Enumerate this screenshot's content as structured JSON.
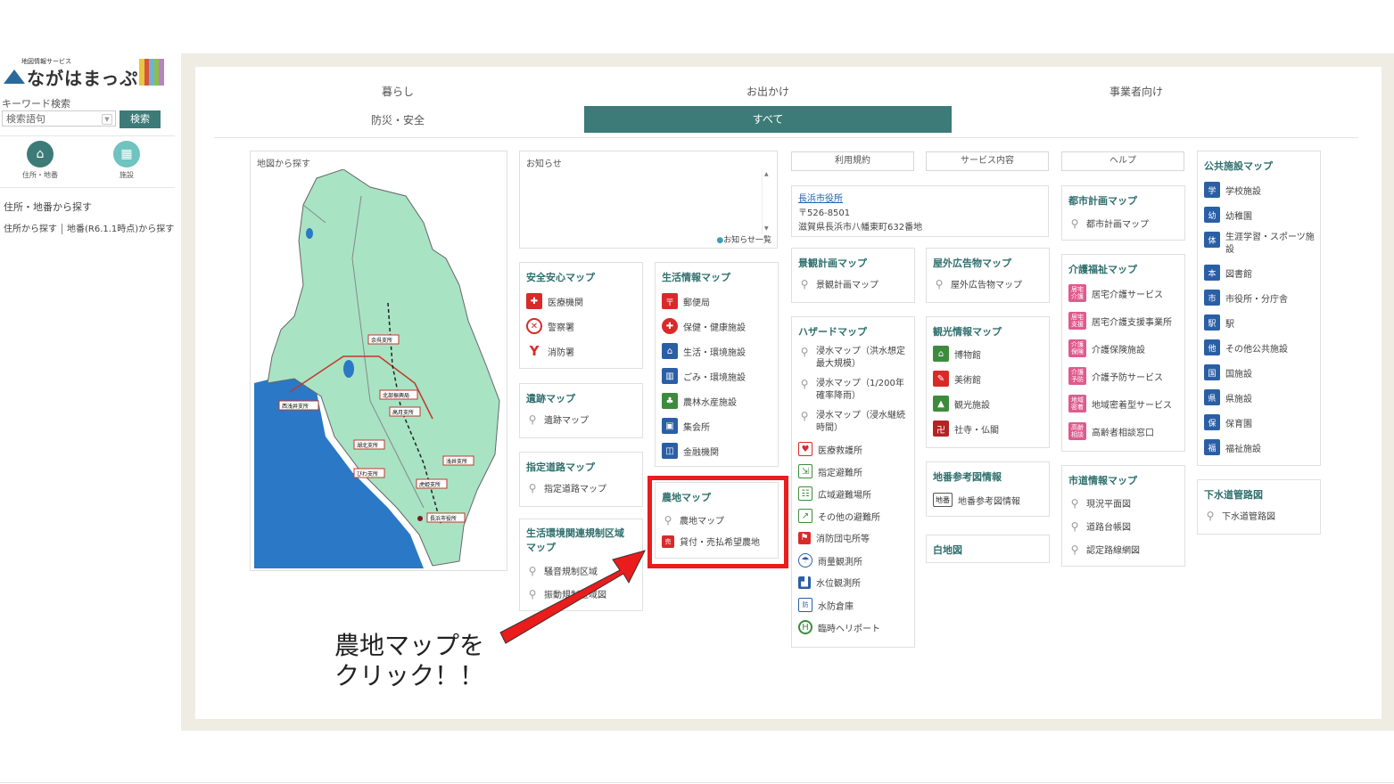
{
  "sidebar": {
    "logo_small": "地図情報サービス",
    "logo_text": "ながはまっぷ",
    "keyword_label": "キーワード検索",
    "search_placeholder": "検索語句",
    "search_button": "検索",
    "icon1_label": "住所・地番",
    "icon2_label": "施設",
    "search_title": "住所・地番から探す",
    "link_address": "住所から探す",
    "link_lot": "地番(R6.1.1時点)から探す"
  },
  "tabs": {
    "living": "暮らし",
    "outing": "お出かけ",
    "business": "事業者向け",
    "disaster": "防災・安全",
    "all": "すべて"
  },
  "map_panel": {
    "title": "地図から探す",
    "labels": [
      "余呉支所",
      "北部振興局",
      "高月支所",
      "西浅井支所",
      "湖北支所",
      "びわ支所",
      "浅井支所",
      "虎姫支所",
      "長浜市役所"
    ]
  },
  "news": {
    "title": "お知らせ",
    "list_link": "お知らせ一覧"
  },
  "top_buttons": {
    "terms": "利用規約",
    "service": "サービス内容",
    "help": "ヘルプ"
  },
  "city_office": {
    "name": "長浜市役所",
    "postal": "〒526-8501",
    "address": "滋賀県長浜市八幡東町632番地"
  },
  "safety": {
    "title": "安全安心マップ",
    "items": [
      "医療機関",
      "警察署",
      "消防署"
    ]
  },
  "ruins": {
    "title": "遺跡マップ",
    "items": [
      "遺跡マップ"
    ]
  },
  "road": {
    "title": "指定道路マップ",
    "items": [
      "指定道路マップ"
    ]
  },
  "env": {
    "title": "生活環境関連規制区域マップ",
    "items": [
      "騒音規制区域",
      "振動規制区域図"
    ]
  },
  "life": {
    "title": "生活情報マップ",
    "items": [
      "郵便局",
      "保健・健康施設",
      "生活・環境施設",
      "ごみ・環境施設",
      "農林水産施設",
      "集会所",
      "金融機関"
    ]
  },
  "farm": {
    "title": "農地マップ",
    "items": [
      "農地マップ",
      "貸付・売払希望農地"
    ]
  },
  "landscape": {
    "title": "景観計画マップ",
    "items": [
      "景観計画マップ"
    ]
  },
  "outdoor_ad": {
    "title": "屋外広告物マップ",
    "items": [
      "屋外広告物マップ"
    ]
  },
  "hazard": {
    "title": "ハザードマップ",
    "items": [
      "浸水マップ（洪水想定最大規模）",
      "浸水マップ（1/200年確率降雨）",
      "浸水マップ（浸水継続時間）",
      "医療救護所",
      "指定避難所",
      "広域避難場所",
      "その他の避難所",
      "消防団屯所等",
      "雨量観測所",
      "水位観測所",
      "水防倉庫",
      "臨時ヘリポート"
    ]
  },
  "tourism": {
    "title": "観光情報マップ",
    "items": [
      "博物館",
      "美術館",
      "観光施設",
      "社寺・仏閣"
    ]
  },
  "lot_ref": {
    "title": "地番参考図情報",
    "items": [
      "地番参考図情報"
    ],
    "icon_text": "地番"
  },
  "blank_map": {
    "title": "白地図"
  },
  "urban": {
    "title": "都市計画マップ",
    "items": [
      "都市計画マップ"
    ]
  },
  "care": {
    "title": "介護福祉マップ",
    "items": [
      "居宅介護サービス",
      "居宅介護支援事業所",
      "介護保険施設",
      "介護予防サービス",
      "地域密着型サービス",
      "高齢者相談窓口"
    ],
    "icon_texts": [
      "居宅介護",
      "居宅支援",
      "介護保険",
      "介護予防",
      "地域密着",
      "高齢相談"
    ]
  },
  "road_info": {
    "title": "市道情報マップ",
    "items": [
      "現況平面図",
      "道路台帳図",
      "認定路線網図"
    ]
  },
  "public": {
    "title": "公共施設マップ",
    "items": [
      "学校施設",
      "幼稚園",
      "生涯学習・スポーツ施設",
      "図書館",
      "市役所・分庁舎",
      "駅",
      "その他公共施設",
      "国施設",
      "県施設",
      "保育園",
      "福祉施設"
    ],
    "icon_texts": [
      "学",
      "幼",
      "体",
      "本",
      "市",
      "駅",
      "他",
      "国",
      "県",
      "保",
      "福"
    ]
  },
  "sewer": {
    "title": "下水道管路図",
    "items": [
      "下水道管路図"
    ]
  },
  "callout": {
    "line1": "農地マップを",
    "line2": "クリック！！"
  },
  "colors": {
    "accent": "#3c7b78",
    "title_color": "#2f6f6d",
    "highlight": "#ea1c1c"
  }
}
